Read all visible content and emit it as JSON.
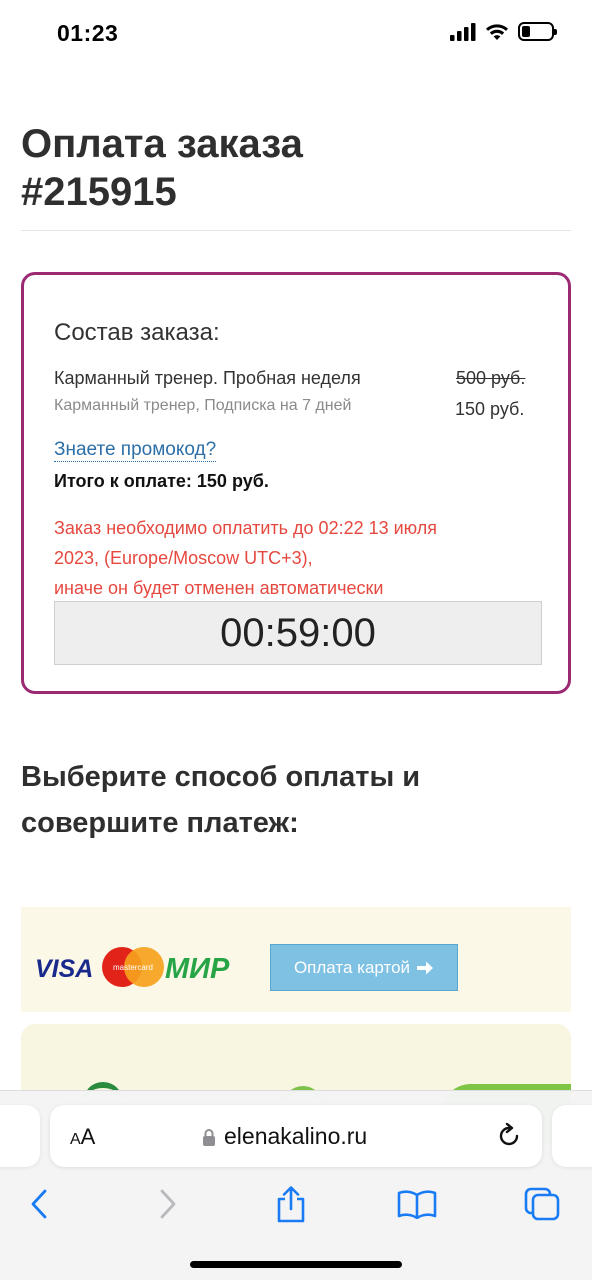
{
  "status_bar": {
    "time": "01:23",
    "icons": [
      "cellular-signal-icon",
      "wifi-icon",
      "battery-icon"
    ]
  },
  "page": {
    "title_line1": "Оплата заказа",
    "title_line2": "#215915"
  },
  "order": {
    "heading": "Состав заказа:",
    "item_name": "Карманный тренер. Пробная неделя",
    "item_subtitle": "Карманный тренер, Подписка на 7 дней",
    "price_old": "500 руб.",
    "price_new": "150 руб.",
    "promo_link": "Знаете промокод?",
    "total": "Итого к оплате: 150 руб.",
    "warning_line1": "Заказ необходимо оплатить до 02:22 13 июля",
    "warning_line2": "2023, (Europe/Moscow UTC+3),",
    "warning_line3": "иначе он будет отменен автоматически",
    "timer": "00:59:00"
  },
  "payment": {
    "heading_line1": "Выберите способ оплаты и",
    "heading_line2": "совершите платеж:",
    "logos": {
      "visa": "VISA",
      "mastercard": "mastercard",
      "mir": "МИР"
    },
    "card_button": "Оплата картой"
  },
  "browser": {
    "text_size_label_small": "A",
    "text_size_label_large": "A",
    "url": "elenakalino.ru"
  },
  "colors": {
    "order_border": "#9c2a73",
    "warning": "#e5483f",
    "link": "#2d6fa7",
    "pay_button": "#7ec1e3",
    "ios_blue": "#1a7cf5"
  }
}
